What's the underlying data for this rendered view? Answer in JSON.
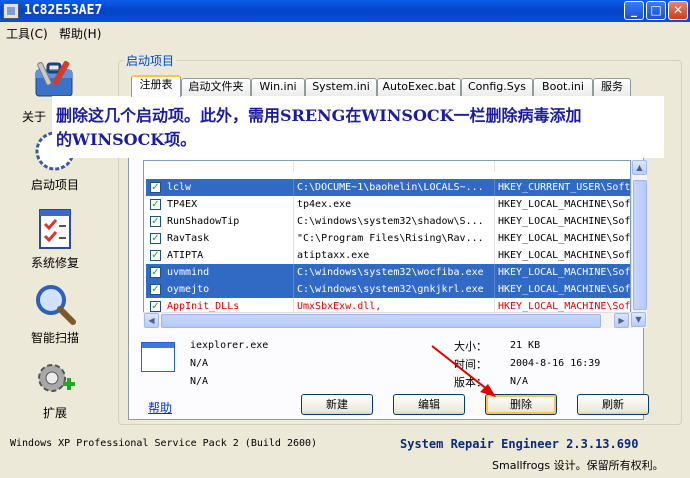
{
  "window": {
    "title": "1C82E53AE7",
    "minimize": "_",
    "maximize": "□",
    "close": "✕"
  },
  "menu": {
    "tools": "工具(C)",
    "help": "帮助(H)"
  },
  "sidebar": {
    "items": [
      {
        "label": "关于",
        "icon": "toolbox-icon"
      },
      {
        "label": "启动项目",
        "icon": "clock-icon"
      },
      {
        "label": "系统修复",
        "icon": "checklist-icon"
      },
      {
        "label": "智能扫描",
        "icon": "magnifier-icon"
      },
      {
        "label": "扩展",
        "icon": "gear-plus-icon"
      }
    ]
  },
  "group_title": "启动项目",
  "tabs": [
    "注册表",
    "启动文件夹",
    "Win.ini",
    "System.ini",
    "AutoExec.bat",
    "Config.Sys",
    "Boot.ini",
    "服务"
  ],
  "overlay_note": {
    "line1": "删除这几个启动项。此外，需用SRENG在WINSOCK一栏删除病毒添加",
    "line2": "的WINSOCK项。"
  },
  "rows": [
    {
      "name": "lclw",
      "path": "C:\\DOCUME~1\\baohelin\\LOCALS~...",
      "key": "HKEY_CURRENT_USER\\Soft",
      "checked": true,
      "selected": true,
      "red": false
    },
    {
      "name": "TP4EX",
      "path": "tp4ex.exe",
      "key": "HKEY_LOCAL_MACHINE\\Sof",
      "checked": true,
      "selected": false,
      "red": false
    },
    {
      "name": "RunShadowTip",
      "path": "C:\\windows\\system32\\shadow\\S...",
      "key": "HKEY_LOCAL_MACHINE\\Sof",
      "checked": true,
      "selected": false,
      "red": false
    },
    {
      "name": "RavTask",
      "path": "\"C:\\Program Files\\Rising\\Rav...",
      "key": "HKEY_LOCAL_MACHINE\\Sof",
      "checked": true,
      "selected": false,
      "red": false
    },
    {
      "name": "ATIPTA",
      "path": "atiptaxx.exe",
      "key": "HKEY_LOCAL_MACHINE\\Sof",
      "checked": true,
      "selected": false,
      "red": false
    },
    {
      "name": "uvmmind",
      "path": "C:\\windows\\system32\\wocfiba.exe",
      "key": "HKEY_LOCAL_MACHINE\\Sof",
      "checked": true,
      "selected": true,
      "red": false
    },
    {
      "name": "oymejto",
      "path": "C:\\windows\\system32\\gnkjkrl.exe",
      "key": "HKEY_LOCAL_MACHINE\\Sof",
      "checked": true,
      "selected": true,
      "red": false
    },
    {
      "name": "AppInit_DLLs",
      "path": "UmxSbxExw.dll,",
      "key": "HKEY_LOCAL_MACHINE\\Sof",
      "checked": true,
      "selected": false,
      "red": true
    }
  ],
  "details": {
    "file": "iexplorer.exe",
    "na1": "N/A",
    "na2": "N/A",
    "size_label": "大小：",
    "size_value": "21 KB",
    "time_label": "时间：",
    "time_value": "2004-8-16 16:39",
    "version_label": "版本：",
    "version_value": "N/A"
  },
  "buttons": {
    "help": "帮助",
    "new": "新建",
    "edit": "编辑",
    "delete": "删除",
    "refresh": "刷新"
  },
  "status": {
    "os": "Windows XP Professional Service Pack 2 (Build 2600)",
    "brand": "System Repair Engineer 2.3.13.690",
    "copyright": "Smallfrogs 设计。保留所有权利。"
  },
  "colors": {
    "title_bar": "#0542c6",
    "selection": "#316ac5",
    "annotation_arrow": "#e00000",
    "note_text": "#1c1c9e"
  }
}
